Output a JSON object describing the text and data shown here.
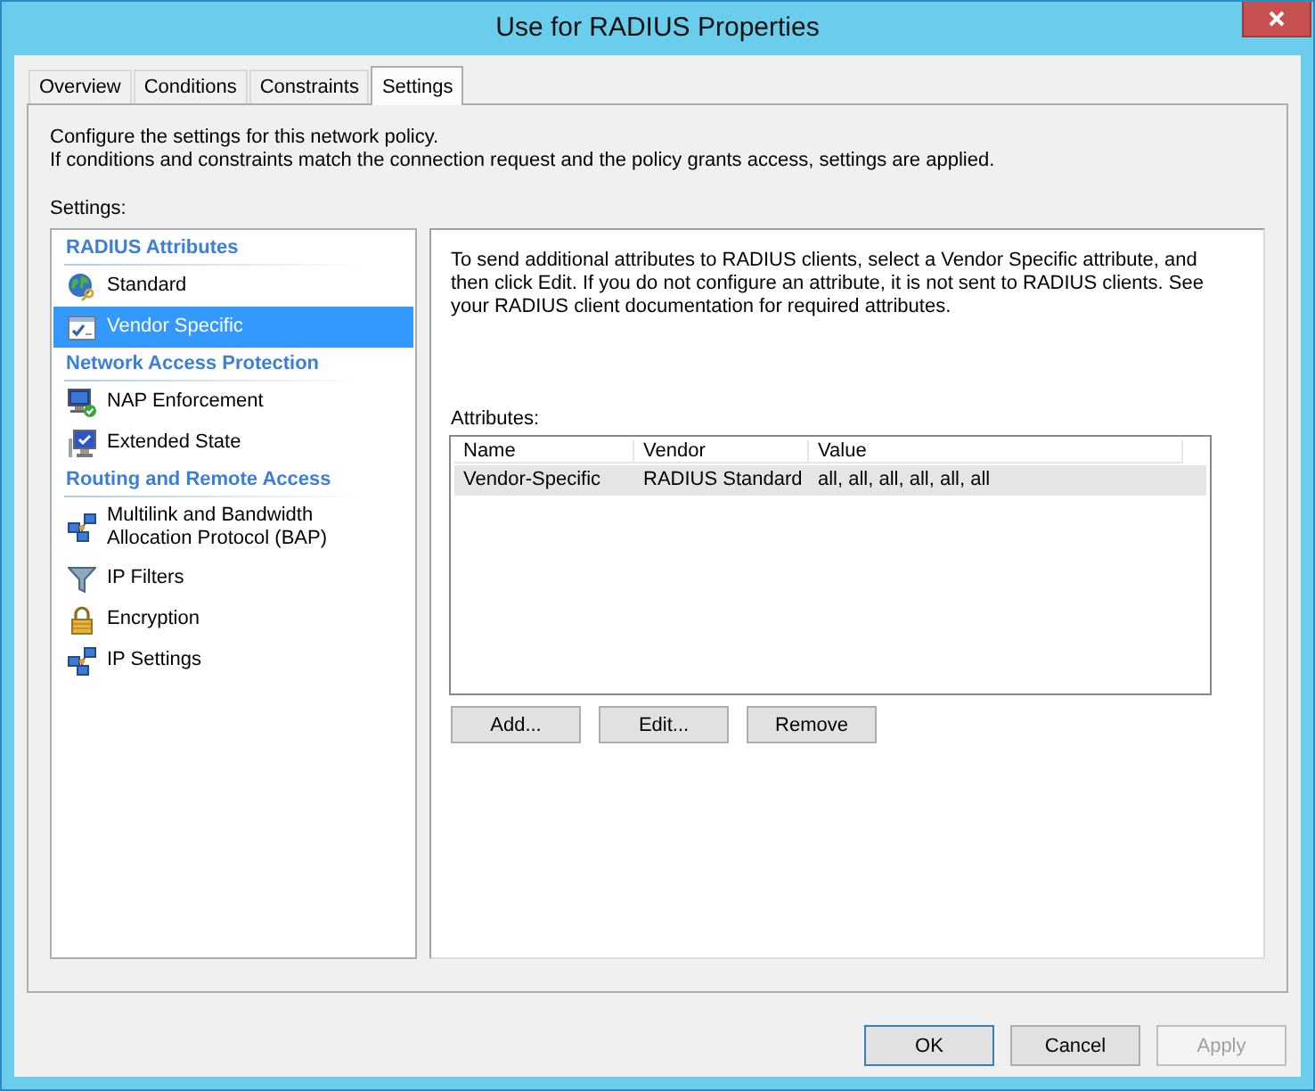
{
  "window": {
    "title": "Use for RADIUS Properties"
  },
  "tabs": [
    {
      "label": "Overview",
      "selected": false
    },
    {
      "label": "Conditions",
      "selected": false
    },
    {
      "label": "Constraints",
      "selected": false
    },
    {
      "label": "Settings",
      "selected": true
    }
  ],
  "intro": [
    "Configure the settings for this network policy.",
    "If conditions and constraints match the connection request and the policy grants access, settings are applied."
  ],
  "settings_label": "Settings:",
  "sidebar": [
    {
      "heading": "RADIUS Attributes",
      "items": [
        {
          "label": "Standard",
          "kind": "globe",
          "selected": false
        },
        {
          "label": "Vendor Specific",
          "kind": "form",
          "selected": true
        }
      ]
    },
    {
      "heading": "Network Access Protection",
      "items": [
        {
          "label": "NAP Enforcement",
          "kind": "health",
          "selected": false
        },
        {
          "label": "Extended State",
          "kind": "state",
          "selected": false
        }
      ]
    },
    {
      "heading": "Routing and Remote Access",
      "items": [
        {
          "label": "Multilink and Bandwidth Allocation Protocol (BAP)",
          "kind": "network",
          "selected": false
        },
        {
          "label": "IP Filters",
          "kind": "funnel",
          "selected": false
        },
        {
          "label": "Encryption",
          "kind": "lock",
          "selected": false
        },
        {
          "label": "IP Settings",
          "kind": "network",
          "selected": false
        }
      ]
    }
  ],
  "detail": {
    "description": "To send additional attributes to RADIUS clients, select a Vendor Specific attribute, and then click Edit. If you do not configure an attribute, it is not sent to RADIUS clients. See your RADIUS client documentation for required attributes.",
    "attributes_label": "Attributes:",
    "table": {
      "columns": [
        "Name",
        "Vendor",
        "Value"
      ],
      "rows": [
        {
          "cells": [
            "Vendor-Specific",
            "RADIUS Standard",
            "all, all, all, all, all, all"
          ],
          "selected": true
        }
      ]
    },
    "buttons": [
      "Add...",
      "Edit...",
      "Remove"
    ]
  },
  "dialog_buttons": [
    {
      "label": "OK",
      "default": true,
      "disabled": false
    },
    {
      "label": "Cancel",
      "default": false,
      "disabled": false
    },
    {
      "label": "Apply",
      "default": false,
      "disabled": true
    }
  ]
}
